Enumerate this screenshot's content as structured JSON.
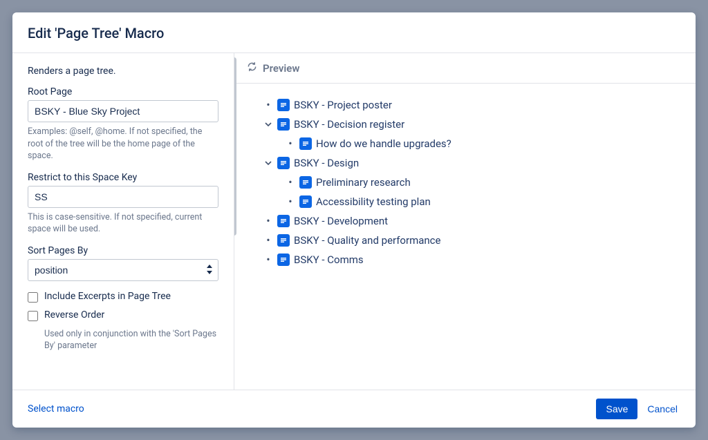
{
  "dialog": {
    "title": "Edit 'Page Tree' Macro"
  },
  "form": {
    "description": "Renders a page tree.",
    "root_page": {
      "label": "Root Page",
      "value": "BSKY - Blue Sky Project",
      "help": "Examples: @self, @home. If not specified, the root of the tree will be the home page of the space."
    },
    "space_key": {
      "label": "Restrict to this Space Key",
      "value": "SS",
      "help": "This is case-sensitive. If not specified, current space will be used."
    },
    "sort_by": {
      "label": "Sort Pages By",
      "value": "position"
    },
    "include_excerpts": {
      "label": "Include Excerpts in Page Tree",
      "checked": false
    },
    "reverse_order": {
      "label": "Reverse Order",
      "checked": false,
      "help": "Used only in conjunction with the 'Sort Pages By' parameter"
    }
  },
  "preview": {
    "title": "Preview",
    "tree": [
      {
        "label": "BSKY - Project poster",
        "marker": "bullet"
      },
      {
        "label": "BSKY - Decision register",
        "marker": "expanded",
        "children": [
          {
            "label": "How do we handle upgrades?",
            "marker": "bullet"
          }
        ]
      },
      {
        "label": "BSKY - Design",
        "marker": "expanded",
        "children": [
          {
            "label": "Preliminary research",
            "marker": "bullet"
          },
          {
            "label": "Accessibility testing plan",
            "marker": "bullet"
          }
        ]
      },
      {
        "label": "BSKY - Development",
        "marker": "bullet"
      },
      {
        "label": "BSKY - Quality and performance",
        "marker": "bullet"
      },
      {
        "label": "BSKY - Comms",
        "marker": "bullet"
      }
    ]
  },
  "footer": {
    "select_macro": "Select macro",
    "save": "Save",
    "cancel": "Cancel"
  }
}
